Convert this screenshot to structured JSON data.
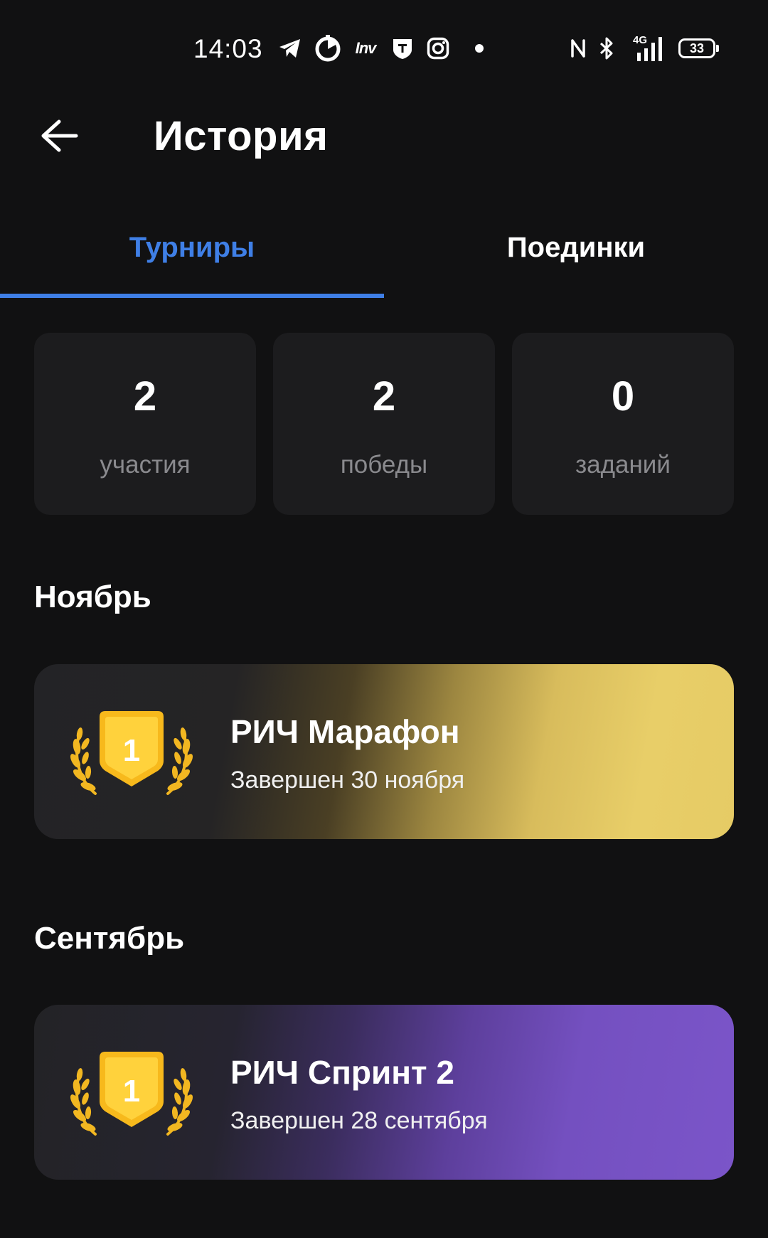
{
  "status_bar": {
    "time": "14:03",
    "notification_icons": [
      "telegram-icon",
      "timer-icon",
      "inv-app-icon",
      "shield-app-icon",
      "instagram-icon",
      "more-dot-icon"
    ],
    "inv_text": "Inv",
    "network_type": "4G",
    "battery_level": "33",
    "system_icons": [
      "nfc-icon",
      "bluetooth-icon",
      "signal-icon",
      "battery-icon"
    ]
  },
  "header": {
    "title": "История",
    "back_icon": "arrow-left-icon"
  },
  "tabs": [
    {
      "label": "Турниры",
      "active": true
    },
    {
      "label": "Поединки",
      "active": false
    }
  ],
  "accent_color": "#3f7fe6",
  "stats": [
    {
      "value": "2",
      "label": "участия"
    },
    {
      "value": "2",
      "label": "победы"
    },
    {
      "value": "0",
      "label": "заданий"
    }
  ],
  "sections": [
    {
      "title": "Ноябрь",
      "items": [
        {
          "title": "РИЧ Марафон",
          "subtitle": "Завершен 30 ноября",
          "place": "1",
          "theme_color": "#e6cb65"
        }
      ]
    },
    {
      "title": "Сентябрь",
      "items": [
        {
          "title": "РИЧ Спринт 2",
          "subtitle": "Завершен 28 сентября",
          "place": "1",
          "theme_color": "#7b55c9"
        }
      ]
    }
  ]
}
